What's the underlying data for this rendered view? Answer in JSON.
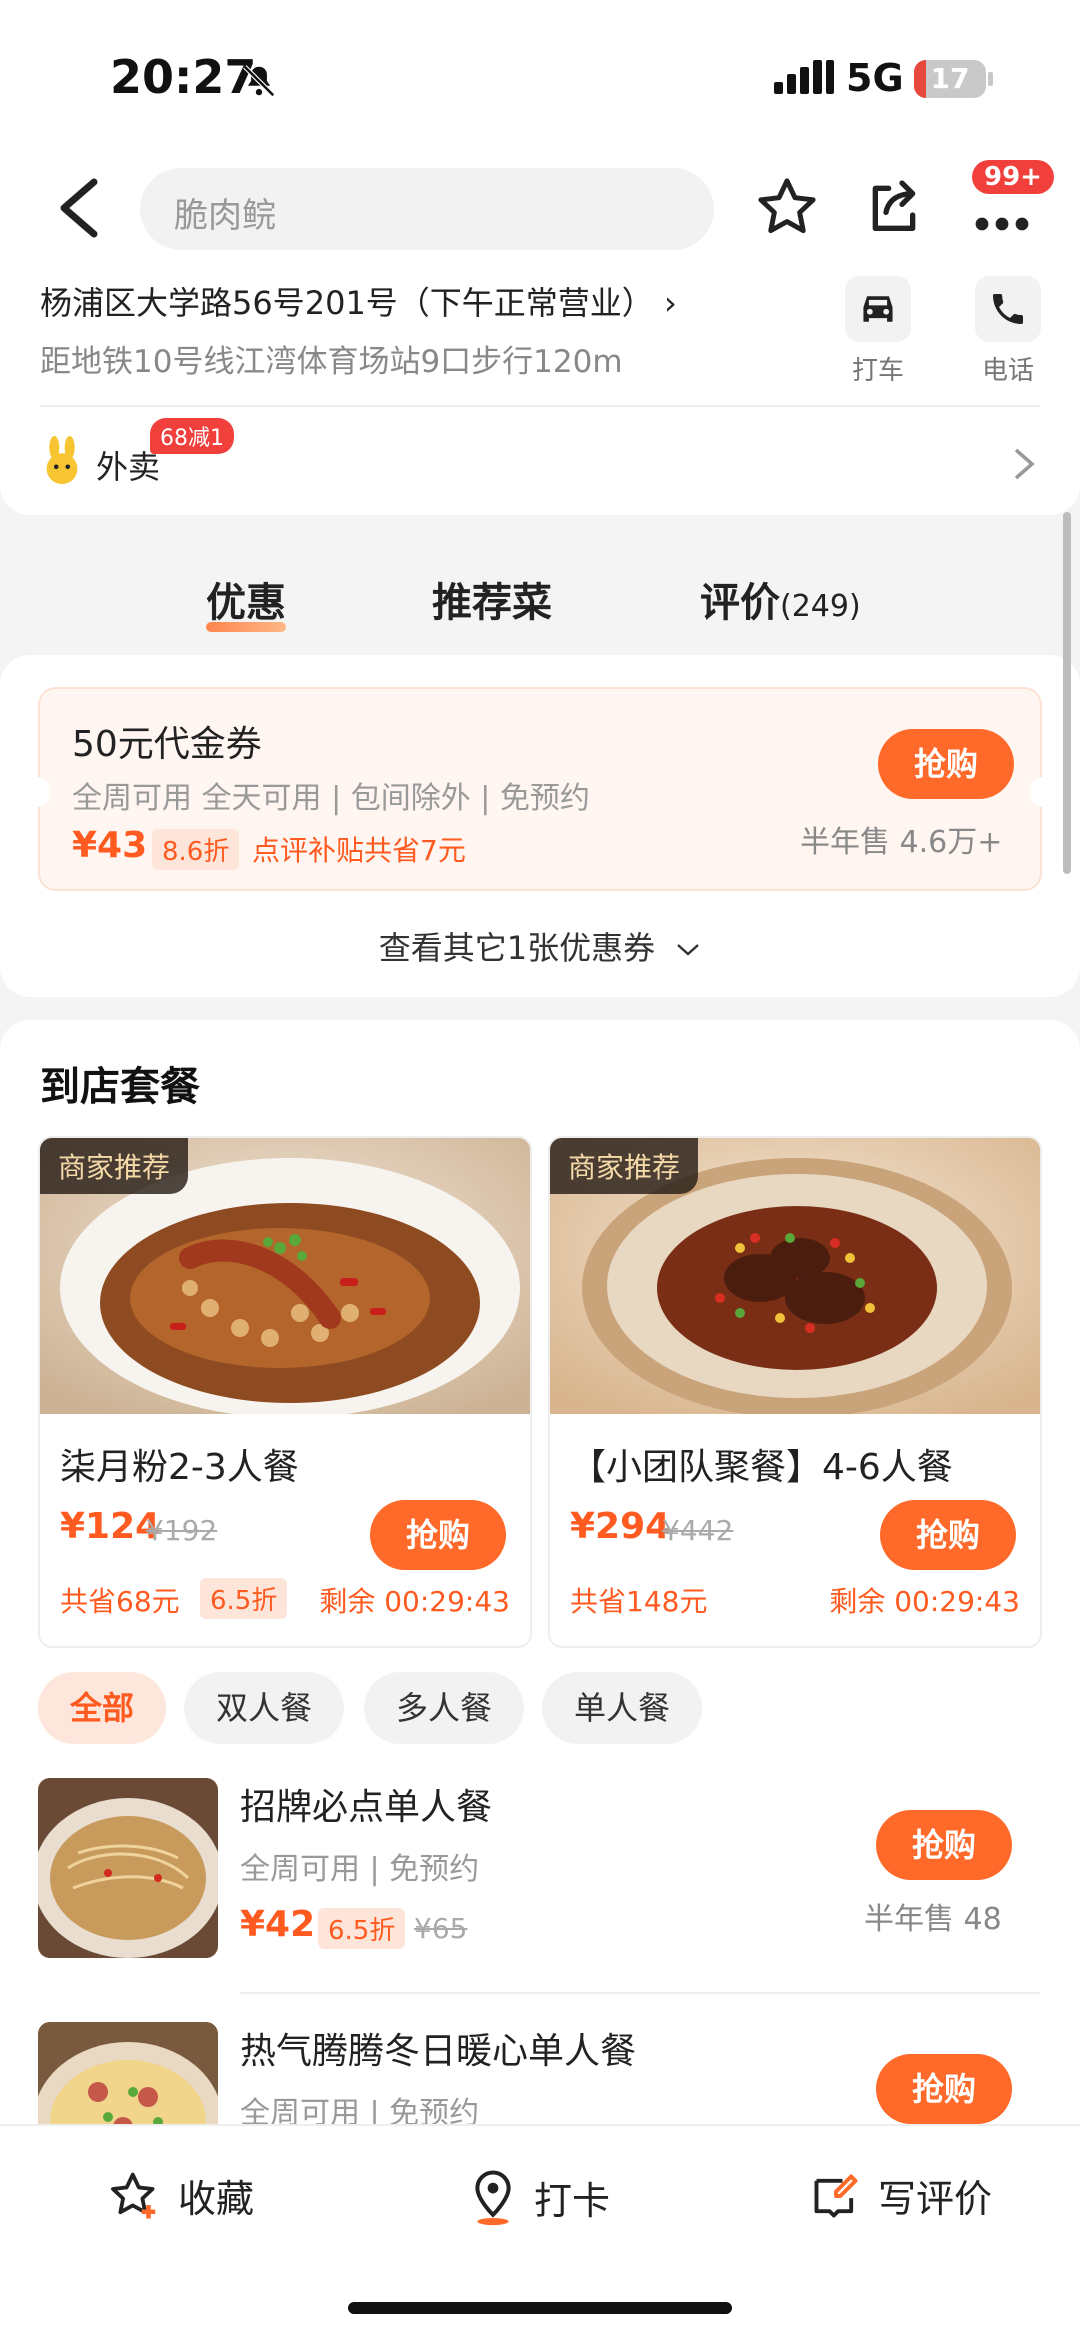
{
  "status": {
    "time": "20:27",
    "network": "5G",
    "battery": "17",
    "battery_level": 0.17
  },
  "header": {
    "search_placeholder": "脆肉鲩",
    "more_badge": "99+"
  },
  "address": {
    "main": "杨浦区大学路56号201号（下午正常营业）",
    "sub": "距地铁10号线江湾体育场站9口步行120m",
    "actions": [
      {
        "label": "打车",
        "icon": "car-icon"
      },
      {
        "label": "电话",
        "icon": "phone-icon"
      }
    ]
  },
  "takeout": {
    "label": "外卖",
    "badge": "68减1"
  },
  "tabs": [
    {
      "label": "优惠"
    },
    {
      "label": "推荐菜"
    },
    {
      "label": "评价",
      "count": "(249)"
    }
  ],
  "coupon": {
    "title": "50元代金券",
    "terms": "全周可用 全天可用 | 包间除外 | 免预约",
    "price": "¥43",
    "discount": "8.6折",
    "saving": "点评补贴共省7元",
    "buy": "抢购",
    "sold": "半年售 4.6万+",
    "more": "查看其它1张优惠券"
  },
  "packages": {
    "title": "到店套餐",
    "cards": [
      {
        "tag": "商家推荐",
        "name": "柒月粉2-3人餐",
        "price": "¥124",
        "original": "¥192",
        "buy": "抢购",
        "saving": "共省68元",
        "discount": "6.5折",
        "timer": "剩余 00:29:43"
      },
      {
        "tag": "商家推荐",
        "name": "【小团队聚餐】4-6人餐",
        "price": "¥294",
        "original": "¥442",
        "buy": "抢购",
        "saving": "共省148元",
        "discount": "",
        "timer": "剩余 00:29:43"
      }
    ],
    "filters": [
      "全部",
      "双人餐",
      "多人餐",
      "单人餐"
    ],
    "items": [
      {
        "name": "招牌必点单人餐",
        "terms": "全周可用 | 免预约",
        "price": "¥42",
        "discount": "6.5折",
        "original": "¥65",
        "buy": "抢购",
        "sold": "半年售 48"
      },
      {
        "name": "热气腾腾冬日暖心单人餐",
        "terms": "全周可用 | 免预约",
        "price": "",
        "discount": "",
        "original": "",
        "buy": "抢购",
        "sold": ""
      }
    ]
  },
  "bottom_bar": [
    {
      "label": "收藏"
    },
    {
      "label": "打卡"
    },
    {
      "label": "写评价"
    }
  ],
  "colors": {
    "accent": "#ff6a2a",
    "price": "#ff5a1f",
    "badge": "#f1403b"
  }
}
